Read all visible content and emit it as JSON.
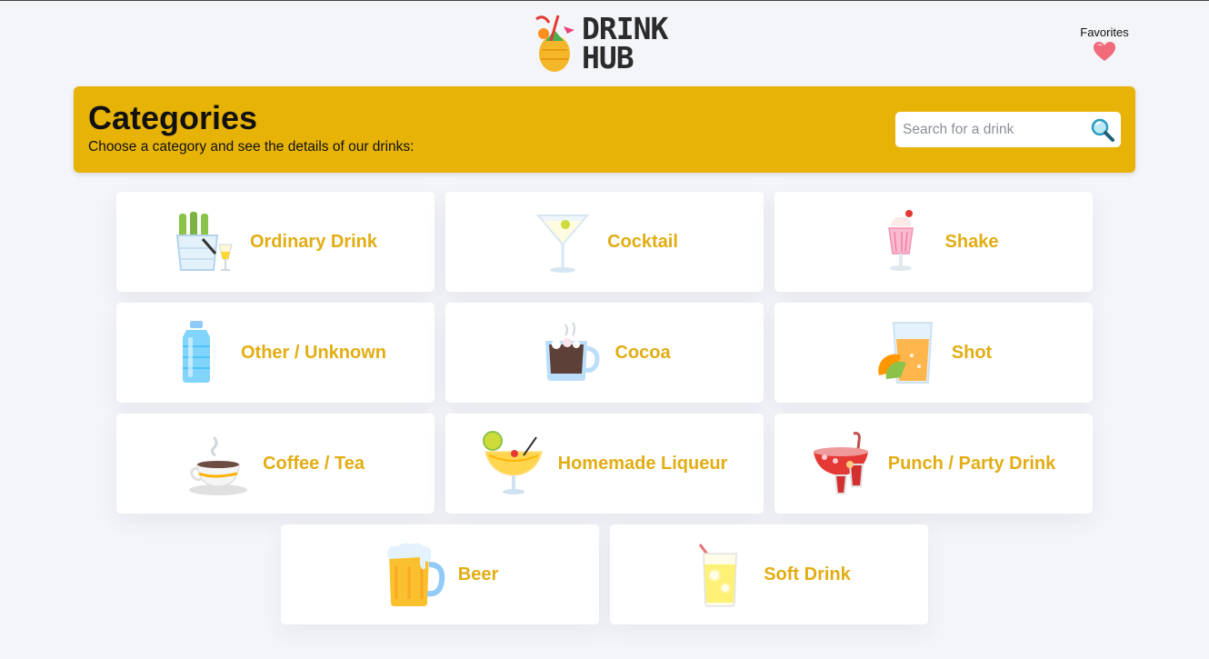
{
  "header": {
    "logo_line1": "DRINK",
    "logo_line2": "HUB",
    "favorites_label": "Favorites"
  },
  "banner": {
    "title": "Categories",
    "subtitle": "Choose a category and see the details of our drinks:",
    "search_placeholder": "Search for a drink"
  },
  "categories": [
    {
      "label": "Ordinary Drink",
      "icon": "beer-bucket-icon"
    },
    {
      "label": "Cocktail",
      "icon": "martini-icon"
    },
    {
      "label": "Shake",
      "icon": "milkshake-icon"
    },
    {
      "label": "Other / Unknown",
      "icon": "water-bottle-icon"
    },
    {
      "label": "Cocoa",
      "icon": "cocoa-mug-icon"
    },
    {
      "label": "Shot",
      "icon": "orange-juice-glass-icon"
    },
    {
      "label": "Coffee / Tea",
      "icon": "teacup-icon"
    },
    {
      "label": "Homemade Liqueur",
      "icon": "tropical-cocktail-icon"
    },
    {
      "label": "Punch / Party Drink",
      "icon": "punch-bowl-icon"
    },
    {
      "label": "Beer",
      "icon": "beer-mug-icon"
    },
    {
      "label": "Soft Drink",
      "icon": "lemonade-icon"
    }
  ],
  "colors": {
    "accent": "#e7b307",
    "label": "#e2ad13",
    "background": "#f4f5f9"
  }
}
